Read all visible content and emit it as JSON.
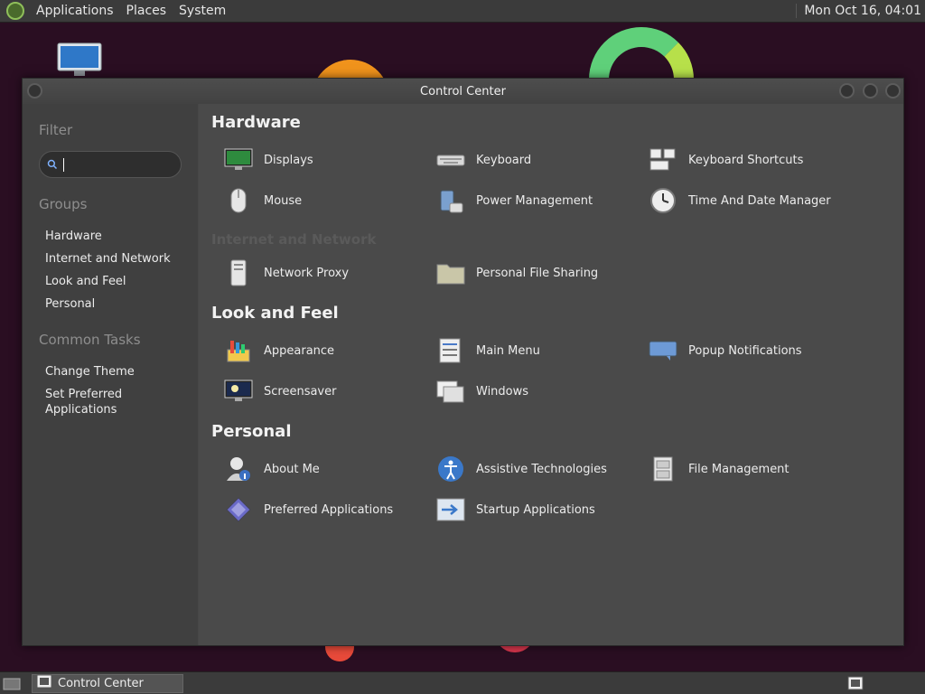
{
  "top_panel": {
    "menus": [
      "Applications",
      "Places",
      "System"
    ],
    "clock": "Mon Oct 16, 04:01"
  },
  "window": {
    "title": "Control Center"
  },
  "sidebar": {
    "filter_title": "Filter",
    "search_value": "",
    "groups_title": "Groups",
    "groups": [
      "Hardware",
      "Internet and Network",
      "Look and Feel",
      "Personal"
    ],
    "tasks_title": "Common Tasks",
    "tasks": [
      "Change Theme",
      "Set Preferred\nApplications"
    ]
  },
  "content": {
    "hardware": {
      "title": "Hardware",
      "items": [
        "Displays",
        "Keyboard",
        "Keyboard Shortcuts",
        "Mouse",
        "Power Management",
        "Time And Date Manager"
      ]
    },
    "internet": {
      "title": "Internet and Network",
      "items": [
        "Network Proxy",
        "Personal File Sharing"
      ]
    },
    "look": {
      "title": "Look and Feel",
      "items": [
        "Appearance",
        "Main Menu",
        "Popup Notifications",
        "Screensaver",
        "Windows"
      ]
    },
    "personal": {
      "title": "Personal",
      "items": [
        "About Me",
        "Assistive Technologies",
        "File Management",
        "Preferred Applications",
        "Startup Applications"
      ]
    }
  },
  "bottom_panel": {
    "task_label": "Control Center"
  },
  "colors": {
    "panel": "#3b3b3b",
    "window_bg": "#4a4a4a",
    "sidebar_bg": "#404040"
  }
}
